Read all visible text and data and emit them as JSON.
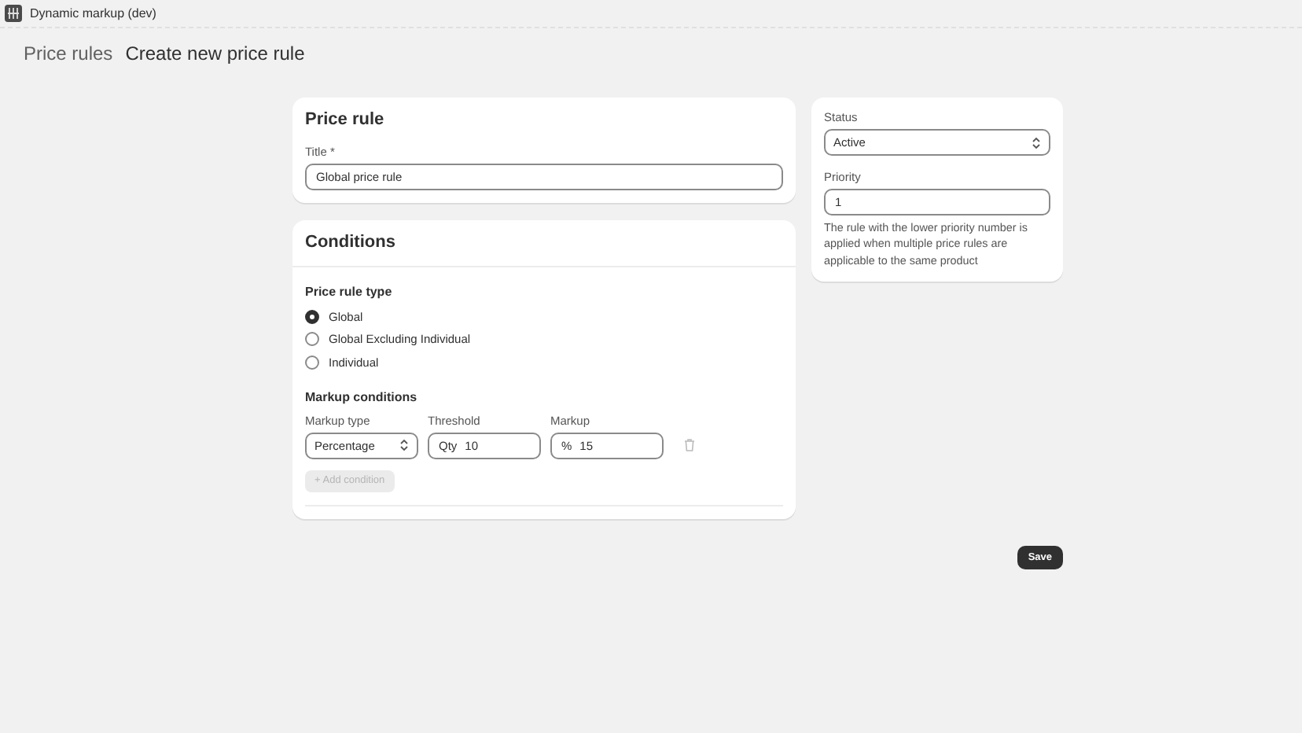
{
  "app_bar": {
    "title": "Dynamic markup (dev)"
  },
  "breadcrumb": {
    "parent": "Price rules",
    "current": "Create new price rule"
  },
  "price_rule_card": {
    "heading": "Price rule",
    "title_label": "Title *",
    "title_value": "Global price rule"
  },
  "conditions_card": {
    "heading": "Conditions",
    "type_label": "Price rule type",
    "types": [
      {
        "label": "Global",
        "selected": true
      },
      {
        "label": "Global Excluding Individual",
        "selected": false
      },
      {
        "label": "Individual",
        "selected": false
      }
    ],
    "markup_heading": "Markup conditions",
    "columns": [
      "Markup type",
      "Threshold",
      "Markup"
    ],
    "rows": [
      {
        "markup_type": "Percentage",
        "threshold_prefix": "Qty",
        "threshold": "10",
        "markup_prefix": "%",
        "markup": "15"
      }
    ],
    "add_button": {
      "label": "+ Add condition",
      "disabled": true
    }
  },
  "side_card": {
    "status_label": "Status",
    "status_value": "Active",
    "priority_label": "Priority",
    "priority_value": "1",
    "help": "The rule with the lower priority number is applied when multiple price rules are applicable to the same product"
  },
  "save_button": "Save"
}
